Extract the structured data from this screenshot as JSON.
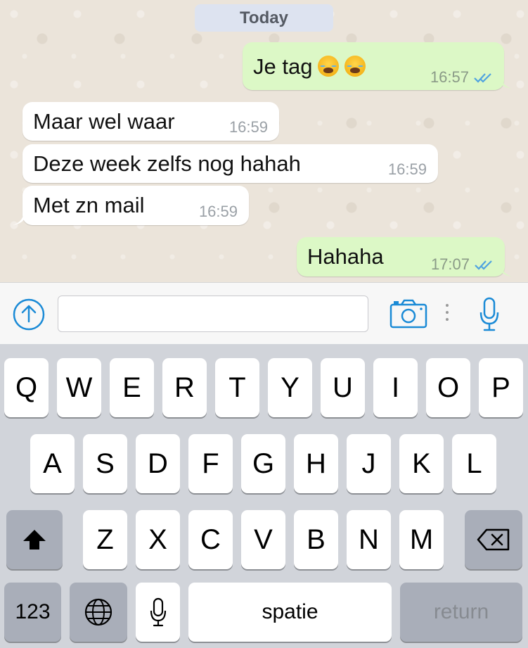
{
  "chat": {
    "date_label": "Today",
    "messages": [
      {
        "direction": "outgoing",
        "text": "Je tag",
        "emoji": [
          "loudly-crying-face",
          "loudly-crying-face"
        ],
        "time": "16:57",
        "status": "read"
      },
      {
        "direction": "incoming",
        "text": "Maar wel waar",
        "time": "16:59"
      },
      {
        "direction": "incoming",
        "text": "Deze week zelfs nog hahah",
        "time": "16:59"
      },
      {
        "direction": "incoming",
        "text": "Met zn mail",
        "time": "16:59"
      },
      {
        "direction": "outgoing",
        "text": "Hahaha",
        "time": "17:07",
        "status": "read"
      }
    ]
  },
  "input_bar": {
    "message_value": "",
    "icons": [
      "share-up-icon",
      "camera-icon",
      "more-dots-icon",
      "microphone-icon"
    ],
    "accent_color": "#1a8ad6"
  },
  "keyboard": {
    "row1": [
      "Q",
      "W",
      "E",
      "R",
      "T",
      "Y",
      "U",
      "I",
      "O",
      "P"
    ],
    "row2": [
      "A",
      "S",
      "D",
      "F",
      "G",
      "H",
      "J",
      "K",
      "L"
    ],
    "row3": [
      "Z",
      "X",
      "C",
      "V",
      "B",
      "N",
      "M"
    ],
    "numbers_label": "123",
    "space_label": "spatie",
    "return_label": "return",
    "icons": [
      "shift-icon",
      "backspace-icon",
      "globe-icon",
      "dictation-mic-icon"
    ]
  },
  "colors": {
    "incoming_bubble": "#ffffff",
    "outgoing_bubble": "#dcf8c6",
    "read_ticks": "#4fa3e0",
    "chat_background": "#ebe4da"
  }
}
